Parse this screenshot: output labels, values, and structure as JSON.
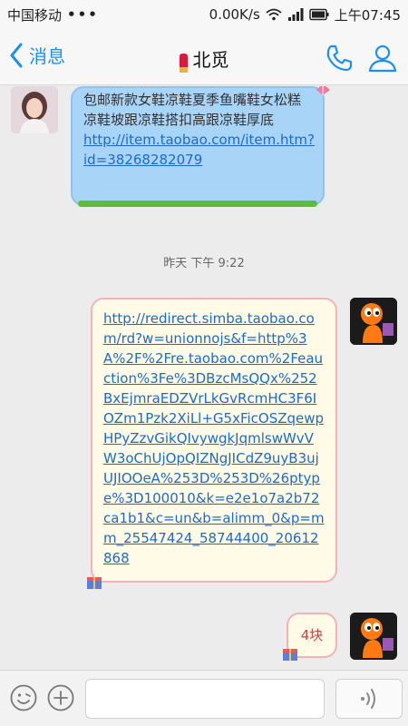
{
  "status_bar": {
    "carrier": "中国移动",
    "dots": "•••",
    "net_speed": "0.00K/s",
    "time": "上午07:45"
  },
  "header": {
    "back_label": "消息",
    "title": "北觅"
  },
  "messages": {
    "m1_text": "包邮新款女鞋凉鞋夏季鱼嘴鞋女松糕凉鞋坡跟凉鞋搭扣高跟凉鞋厚底",
    "m1_link": "http://item.taobao.com/item.htm?id=38268282079",
    "timestamp": "昨天 下午 9:22",
    "m2_link": "http://redirect.simba.taobao.com/rd?w=unionnojs&f=http%3A%2F%2Fre.taobao.com%2Feauction%3Fe%3DBzcMsQQx%252BxEjmraEDZVrLkGvRcmHC3F6IOZm1Pzk2XiLl+G5xFicOSZqewpHPyZzvGikQIvywgkJqmlswWvVW3oChUjOpQIZNgJICdZ9uyB3ujUJIOOeA%253D%253D%26ptype%3D100010&k=e2e1o7a2b72ca1b1&c=un&b=alimm_0&p=mm_25547424_58744400_20612868",
    "m3_text": "4块"
  },
  "icons": {
    "back": "chevron-left-icon",
    "call": "phone-icon",
    "profile": "person-icon",
    "emoji": "smiley-icon",
    "more": "plus-icon",
    "voice": "sound-wave-icon"
  },
  "colors": {
    "accent": "#1e90e8",
    "bubble_blue": "#a8d4f8",
    "bubble_cream": "#fffbe6",
    "bubble_border_pink": "#f3b1b8",
    "link": "#1b6bc8"
  }
}
